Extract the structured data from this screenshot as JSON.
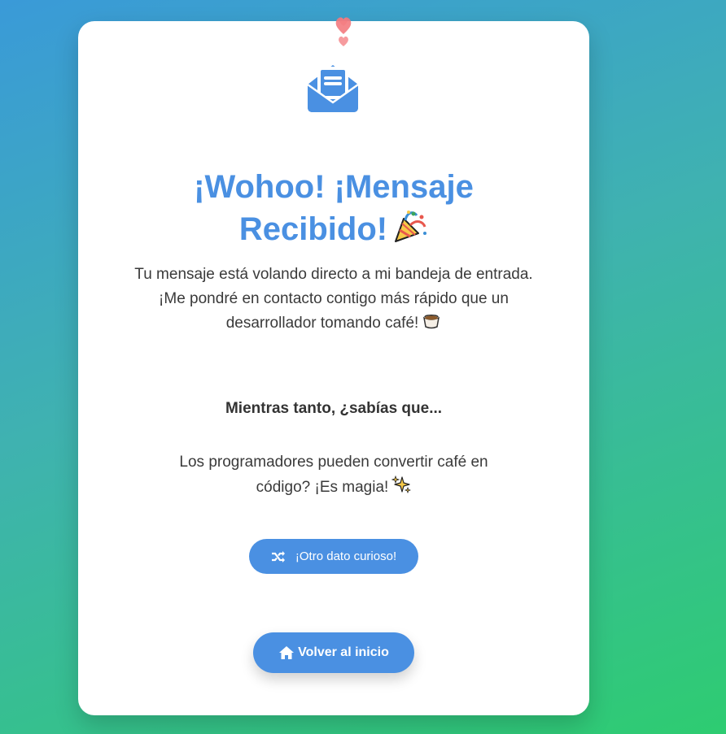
{
  "hero": {
    "icon": "envelope-open-text-icon",
    "decoration": "floating-hearts-icon",
    "title_line1": "¡Wohoo! ¡Mensaje",
    "title_line2": "Recibido!",
    "title_emoji": "party-popper-icon"
  },
  "message": {
    "line1": "Tu mensaje está volando directo a mi bandeja de entrada.",
    "line2": "¡Me pondré en contacto contigo más rápido que un",
    "line3": "desarrollador tomando café!",
    "emoji": "coffee-icon"
  },
  "fun_fact": {
    "heading": "Mientras tanto, ¿sabías que...",
    "line1": "Los programadores pueden convertir café en",
    "line2": "código? ¡Es magia!",
    "emoji": "sparkles-icon"
  },
  "buttons": {
    "another_fact": "¡Otro dato curioso!",
    "home": "Volver al inicio"
  },
  "colors": {
    "accent": "#4a90e2",
    "background_start": "#3a9ad8",
    "background_end": "#2ecc71",
    "heart": "#f07c80"
  }
}
